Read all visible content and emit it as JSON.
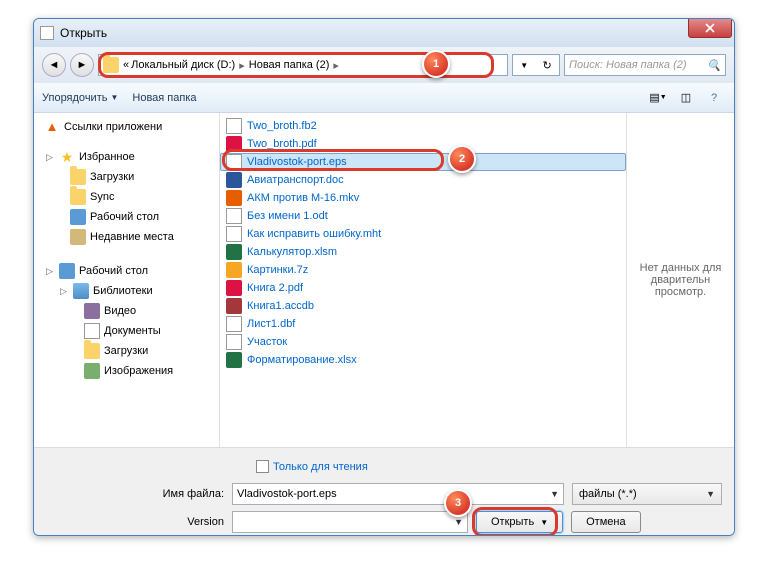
{
  "window": {
    "title": "Открыть"
  },
  "breadcrumb": {
    "prefix": "«",
    "part1": "Локальный диск (D:)",
    "part2": "Новая папка (2)"
  },
  "search": {
    "placeholder": "Поиск: Новая папка (2)"
  },
  "toolbar": {
    "organize": "Упорядочить",
    "new_folder": "Новая папка"
  },
  "sidebar": {
    "app_links": "Ссылки приложени",
    "favorites": "Избранное",
    "fav_items": [
      "Загрузки",
      "Sync",
      "Рабочий стол",
      "Недавние места"
    ],
    "desktop": "Рабочий стол",
    "libraries": "Библиотеки",
    "lib_items": [
      "Видео",
      "Документы",
      "Загрузки",
      "Изображения"
    ]
  },
  "files": [
    "Two_broth.fb2",
    "Two_broth.pdf",
    "Vladivostok-port.eps",
    "Авиатранспорт.doc",
    "АКМ против М-16.mkv",
    "Без имени 1.odt",
    "Как исправить ошибку.mht",
    "Калькулятор.xlsm",
    "Картинки.7z",
    "Книга 2.pdf",
    "Книга1.accdb",
    "Лист1.dbf",
    "Участок",
    "Форматирование.xlsx"
  ],
  "preview": {
    "no_data": "Нет данных для дварительн просмотр."
  },
  "readonly": "Только для чтения",
  "form": {
    "filename_label": "Имя файла:",
    "filename_value": "Vladivostok-port.eps",
    "version_label": "Version",
    "filter": "файлы (*.*)",
    "open": "Открыть",
    "cancel": "Отмена"
  },
  "callouts": {
    "c1": "1",
    "c2": "2",
    "c3": "3"
  }
}
